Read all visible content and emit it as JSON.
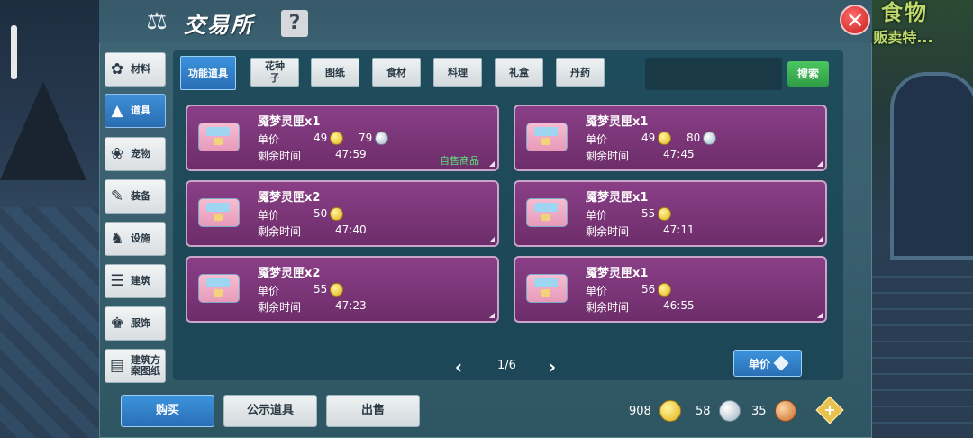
{
  "window": {
    "title": "交易所",
    "help_label": "?",
    "close_label": "✕",
    "icon": "scales-icon"
  },
  "background": {
    "sign_line1": "食物",
    "sign_line2": "(贩卖特..."
  },
  "sidenav": [
    {
      "label": "材料",
      "icon": "materials-icon",
      "active": false
    },
    {
      "label": "道具",
      "icon": "flask-icon",
      "active": true
    },
    {
      "label": "宠物",
      "icon": "paw-icon",
      "active": false
    },
    {
      "label": "装备",
      "icon": "equipment-icon",
      "active": false
    },
    {
      "label": "设施",
      "icon": "horse-icon",
      "active": false
    },
    {
      "label": "建筑",
      "icon": "building-icon",
      "active": false
    },
    {
      "label": "服饰",
      "icon": "clothing-icon",
      "active": false
    },
    {
      "label": "建筑方案图纸",
      "icon": "blueprint-icon",
      "active": false
    }
  ],
  "tabs": [
    {
      "label": "功能道具",
      "active": true
    },
    {
      "label": "花种子",
      "active": false
    },
    {
      "label": "图纸",
      "active": false
    },
    {
      "label": "食材",
      "active": false
    },
    {
      "label": "料理",
      "active": false
    },
    {
      "label": "礼盒",
      "active": false
    },
    {
      "label": "丹药",
      "active": false
    }
  ],
  "search": {
    "value": "",
    "button_label": "搜索"
  },
  "labels": {
    "unit_price": "单价",
    "time_left": "剩余时间",
    "self_sale": "自售商品"
  },
  "listings": [
    {
      "name": "魇梦灵匣x1",
      "price_gold": "49",
      "price_silver": "79",
      "time": "47:59",
      "self_sale": true
    },
    {
      "name": "魇梦灵匣x1",
      "price_gold": "49",
      "price_silver": "80",
      "time": "47:45",
      "self_sale": false
    },
    {
      "name": "魇梦灵匣x2",
      "price_gold": "50",
      "price_silver": "",
      "time": "47:40",
      "self_sale": false
    },
    {
      "name": "魇梦灵匣x1",
      "price_gold": "55",
      "price_silver": "",
      "time": "47:11",
      "self_sale": false
    },
    {
      "name": "魇梦灵匣x2",
      "price_gold": "55",
      "price_silver": "",
      "time": "47:23",
      "self_sale": false
    },
    {
      "name": "魇梦灵匣x1",
      "price_gold": "56",
      "price_silver": "",
      "time": "46:55",
      "self_sale": false
    }
  ],
  "pager": {
    "text": "1/6",
    "prev": "‹",
    "next": "›"
  },
  "sort": {
    "label": "单价"
  },
  "bottom": {
    "buy_label": "购买",
    "showcase_label": "公示道具",
    "sell_label": "出售",
    "gold": "908",
    "silver": "58",
    "bronze": "35",
    "plus_label": "+"
  },
  "colors": {
    "accent": "#2f7fc8",
    "card": "#7a3577",
    "confirm": "#3cb553",
    "self_sale_text": "#5de17a"
  }
}
